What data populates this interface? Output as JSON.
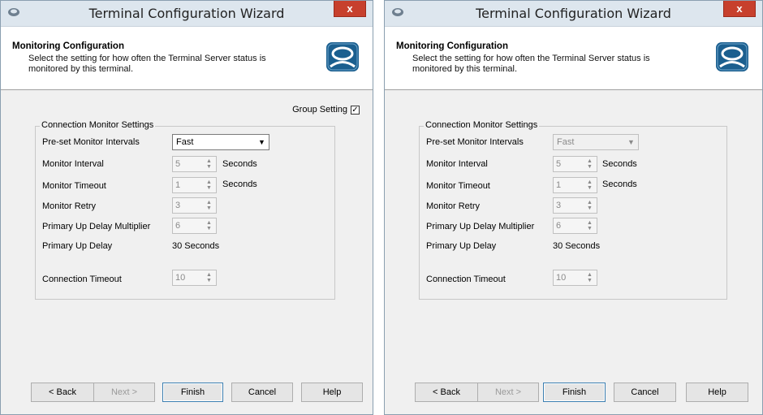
{
  "windows": [
    {
      "title": "Terminal Configuration Wizard",
      "close_label": "x",
      "header": {
        "title": "Monitoring Configuration",
        "description": "Select the setting for how often the Terminal Server status is monitored by this terminal."
      },
      "group_setting": {
        "label": "Group Setting",
        "checked": true,
        "check_glyph": "✓"
      },
      "fieldset_legend": "Connection Monitor Settings",
      "fields": {
        "preset_label": "Pre-set Monitor Intervals",
        "preset_value": "Fast",
        "interval_label": "Monitor Interval",
        "interval_value": "5",
        "interval_unit": "Seconds",
        "timeout_label": "Monitor Timeout",
        "timeout_value": "1",
        "timeout_unit": "Seconds",
        "retry_label": "Monitor Retry",
        "retry_value": "3",
        "multiplier_label": "Primary Up Delay Multiplier",
        "multiplier_value": "6",
        "delay_label": "Primary Up Delay",
        "delay_value": "30 Seconds",
        "conn_timeout_label": "Connection Timeout",
        "conn_timeout_value": "10"
      },
      "buttons": {
        "back": "< Back",
        "next": "Next >",
        "finish": "Finish",
        "cancel": "Cancel",
        "help": "Help"
      }
    },
    {
      "title": "Terminal Configuration Wizard",
      "close_label": "x",
      "header": {
        "title": "Monitoring Configuration",
        "description": "Select the setting for how often the Terminal Server status is monitored by this terminal."
      },
      "fieldset_legend": "Connection Monitor Settings",
      "fields": {
        "preset_label": "Pre-set Monitor Intervals",
        "preset_value": "Fast",
        "interval_label": "Monitor Interval",
        "interval_value": "5",
        "interval_unit": "Seconds",
        "timeout_label": "Monitor Timeout",
        "timeout_value": "1",
        "timeout_unit": "Seconds",
        "retry_label": "Monitor Retry",
        "retry_value": "3",
        "multiplier_label": "Primary Up Delay Multiplier",
        "multiplier_value": "6",
        "delay_label": "Primary Up Delay",
        "delay_value": "30 Seconds",
        "conn_timeout_label": "Connection Timeout",
        "conn_timeout_value": "10"
      },
      "buttons": {
        "back": "< Back",
        "next": "Next >",
        "finish": "Finish",
        "cancel": "Cancel",
        "help": "Help"
      }
    }
  ],
  "icons": {
    "app": "wizard-app-icon",
    "logo": "thinmanager-logo-icon",
    "dropdown": "chevron-down-icon",
    "spinner": "spinner-arrows-icon"
  },
  "colors": {
    "close_button": "#c7402d",
    "titlebar": "#dde6ee",
    "logo_blue": "#1b5f8f",
    "default_button_border": "#3c7fb1"
  }
}
